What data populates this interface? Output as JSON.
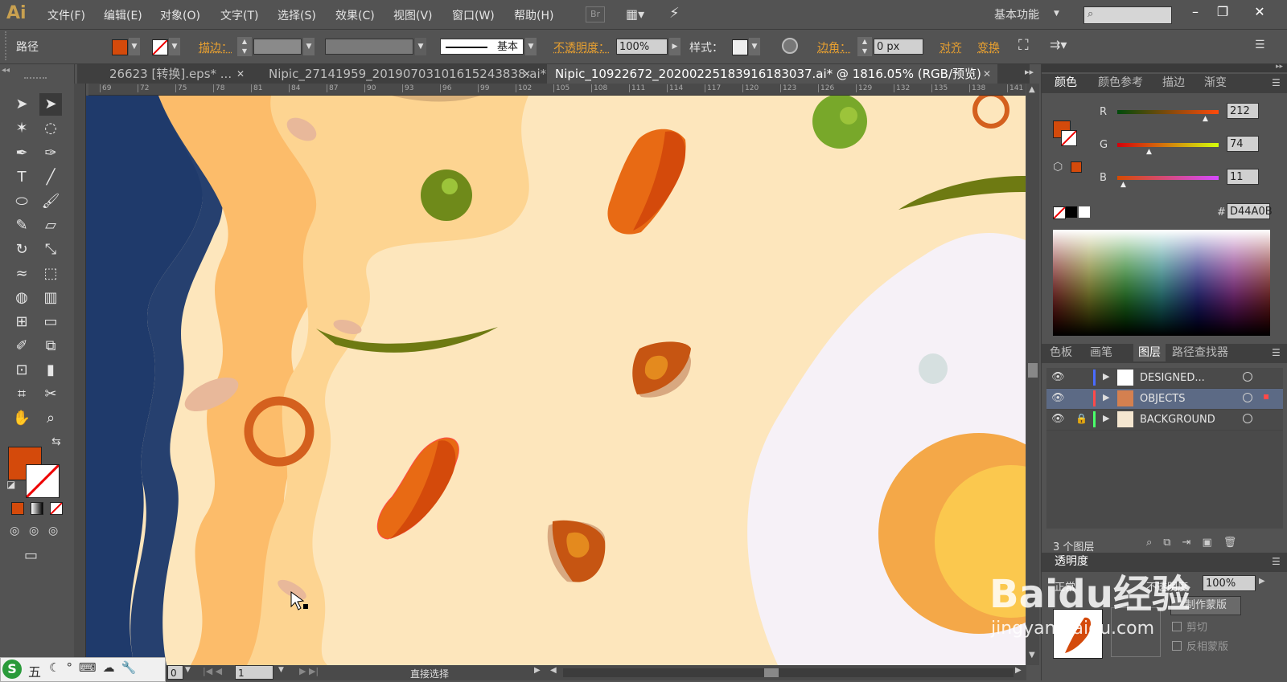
{
  "app": {
    "logo": "Ai",
    "workspace": "基本功能"
  },
  "menu": [
    "文件(F)",
    "编辑(E)",
    "对象(O)",
    "文字(T)",
    "选择(S)",
    "效果(C)",
    "视图(V)",
    "窗口(W)",
    "帮助(H)"
  ],
  "menu_extra": {
    "br": "Br"
  },
  "control": {
    "selection_label": "路径",
    "stroke_label": "描边：",
    "style_label": "基本",
    "opacity_label": "不透明度：",
    "opacity_value": "100%",
    "style2_label": "样式：",
    "corner_label": "边角：",
    "corner_value": "0 px",
    "align_label": "对齐",
    "transform_label": "变换"
  },
  "tabs": [
    {
      "label": "26623 [转换].eps* ...",
      "active": false
    },
    {
      "label": "Nipic_27141959_20190703101615243838.ai*",
      "active": false
    },
    {
      "label": "Nipic_10922672_20200225183916183037.ai* @ 1816.05% (RGB/预览)",
      "active": true
    }
  ],
  "ruler_ticks": [
    "69",
    "72",
    "75",
    "78",
    "81",
    "84",
    "87",
    "90",
    "93",
    "96",
    "99",
    "102",
    "105",
    "108",
    "111",
    "114",
    "117",
    "120",
    "123",
    "126",
    "129",
    "132",
    "135",
    "138",
    "141"
  ],
  "color_panel": {
    "tabs": [
      "颜色",
      "颜色参考",
      "描边",
      "渐变"
    ],
    "r_label": "R",
    "r_value": "212",
    "g_label": "G",
    "g_value": "74",
    "b_label": "B",
    "b_value": "11",
    "hex_label": "#",
    "hex_value": "D44A0B",
    "fill_color": "#D44A0B"
  },
  "layers_panel": {
    "tabs": [
      "色板",
      "画笔",
      "图层",
      "路径查找器"
    ],
    "layers": [
      {
        "name": "DESIGNED...",
        "color": "#4a6cff"
      },
      {
        "name": "OBJECTS",
        "color": "#ff4a4a"
      },
      {
        "name": "BACKGROUND",
        "color": "#4aff6a"
      }
    ],
    "count_label": "3 个图层"
  },
  "transparency_panel": {
    "title": "透明度",
    "mode": "正常",
    "opacity_label": "不透明度",
    "opacity_value": "100%",
    "make_mask": "制作蒙版",
    "clip": "剪切",
    "invert": "反相蒙版"
  },
  "status": {
    "zoom_field": "0",
    "page_field": "1",
    "tool_name": "直接选择"
  },
  "ime": {
    "label": "五"
  },
  "watermark": {
    "main": "Baidu经验",
    "sub": "jingyan.baidu.com"
  }
}
